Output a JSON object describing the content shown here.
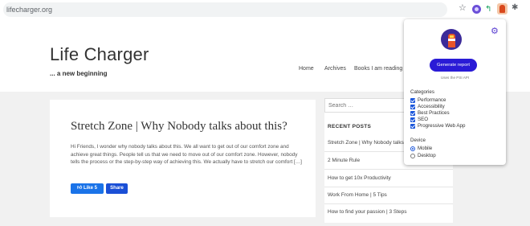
{
  "browser": {
    "url": "lifecharger.org",
    "bookmark_icon": "star-icon",
    "extensions": [
      "extension-purple-icon",
      "extension-green-icon",
      "lighthouse-icon",
      "puzzle-icon"
    ]
  },
  "site": {
    "title": "Life Charger",
    "tagline": "... a new beginning",
    "nav": {
      "home": "Home",
      "archives": "Archives",
      "books": "Books I am reading"
    }
  },
  "post": {
    "title": "Stretch Zone | Why Nobody talks about this?",
    "excerpt": "Hi Friends, I wonder why nobody talks about this. We all want to get out of our comfort zone and achieve great things. People tell us that we need to move out of our comfort zone. However, nobody tells the process or the step-by-step way of achieving this. We actually have to stretch our comfort […]",
    "like_label": "Like 5",
    "share_label": "Share"
  },
  "sidebar": {
    "search_placeholder": "Search …",
    "recent_heading": "RECENT POSTS",
    "recent_posts": [
      "Stretch Zone | Why Nobody talks about this?",
      "2 Minute Rule",
      "How to get 10x Productivity",
      "Work From Home | 5 Tips",
      "How to find your passion | 3 Steps"
    ]
  },
  "popup": {
    "generate_label": "Generate report",
    "uses_api": "Uses the PSI API",
    "categories_title": "Categories",
    "categories": [
      "Performance",
      "Accessibility",
      "Best Practices",
      "SEO",
      "Progressive Web App"
    ],
    "device_title": "Device",
    "devices": [
      "Mobile",
      "Desktop"
    ],
    "selected_device": "Mobile"
  },
  "colors": {
    "accent": "#2a1bd6",
    "lighthouse_bg": "#3b2a99",
    "lighthouse_body": "#e8542a",
    "content_bg": "#f1f1f1"
  }
}
